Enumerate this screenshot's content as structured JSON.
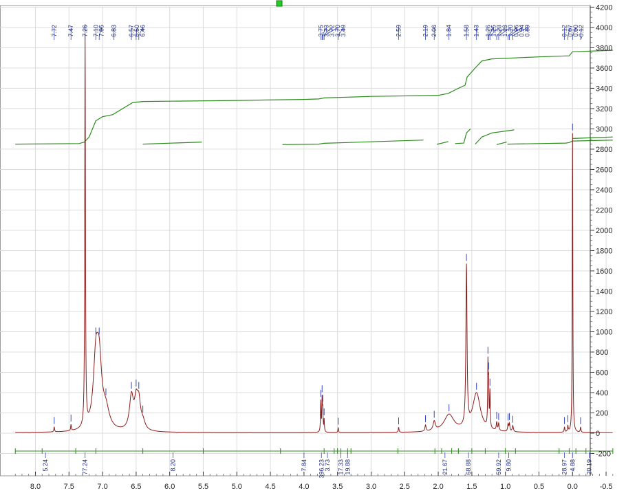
{
  "chart_data": {
    "type": "line",
    "title": "",
    "xlabel": "",
    "ylabel": "",
    "x_reversed": true,
    "xlim": [
      8.3,
      -0.6
    ],
    "ylim": [
      -250,
      4230
    ],
    "grid": true,
    "x_ticks": [
      "8.0",
      "7.5",
      "7.0",
      "6.5",
      "6.0",
      "5.5",
      "5.0",
      "4.5",
      "4.0",
      "3.5",
      "3.0",
      "2.5",
      "2.0",
      "1.5",
      "1.0",
      "0.5",
      "0.0",
      "-0.5"
    ],
    "y_ticks": [
      "4200",
      "4000",
      "3800",
      "3600",
      "3400",
      "3200",
      "3000",
      "2800",
      "2600",
      "2400",
      "2200",
      "2000",
      "1800",
      "1600",
      "1400",
      "1200",
      "1000",
      "800",
      "600",
      "400",
      "200",
      "0",
      "-200"
    ],
    "spectrum": {
      "name": "1H spectrum",
      "color": "#8b1a1a",
      "baseline": 5,
      "peaks": [
        {
          "ppm": 7.72,
          "height": 50,
          "width": 0.006
        },
        {
          "ppm": 7.47,
          "height": 60,
          "width": 0.006
        },
        {
          "ppm": 7.26,
          "height": 3850,
          "width": 0.006
        },
        {
          "ppm": 7.1,
          "height": 640,
          "width": 0.045
        },
        {
          "ppm": 7.05,
          "height": 600,
          "width": 0.045
        },
        {
          "ppm": 6.95,
          "height": 180,
          "width": 0.06
        },
        {
          "ppm": 6.57,
          "height": 330,
          "width": 0.035
        },
        {
          "ppm": 6.5,
          "height": 250,
          "width": 0.03
        },
        {
          "ppm": 6.46,
          "height": 250,
          "width": 0.03
        },
        {
          "ppm": 6.4,
          "height": 80,
          "width": 0.04
        },
        {
          "ppm": 3.75,
          "height": 300,
          "width": 0.005
        },
        {
          "ppm": 3.73,
          "height": 310,
          "width": 0.005
        },
        {
          "ppm": 3.72,
          "height": 200,
          "width": 0.005
        },
        {
          "ppm": 3.7,
          "height": 120,
          "width": 0.005
        },
        {
          "ppm": 3.49,
          "height": 50,
          "width": 0.005
        },
        {
          "ppm": 2.59,
          "height": 50,
          "width": 0.006
        },
        {
          "ppm": 2.19,
          "height": 60,
          "width": 0.01
        },
        {
          "ppm": 2.06,
          "height": 90,
          "width": 0.02
        },
        {
          "ppm": 1.84,
          "height": 170,
          "width": 0.09
        },
        {
          "ppm": 1.58,
          "height": 1580,
          "width": 0.01
        },
        {
          "ppm": 1.43,
          "height": 380,
          "width": 0.07
        },
        {
          "ppm": 1.26,
          "height": 600,
          "width": 0.005
        },
        {
          "ppm": 1.25,
          "height": 400,
          "width": 0.005
        },
        {
          "ppm": 1.23,
          "height": 350,
          "width": 0.005
        },
        {
          "ppm": 1.13,
          "height": 80,
          "width": 0.008
        },
        {
          "ppm": 1.1,
          "height": 70,
          "width": 0.008
        },
        {
          "ppm": 0.96,
          "height": 70,
          "width": 0.008
        },
        {
          "ppm": 0.94,
          "height": 75,
          "width": 0.008
        },
        {
          "ppm": 0.89,
          "height": 60,
          "width": 0.01
        },
        {
          "ppm": 0.12,
          "height": 50,
          "width": 0.006
        },
        {
          "ppm": 0.07,
          "height": 60,
          "width": 0.006
        },
        {
          "ppm": 0.0,
          "height": 2950,
          "width": 0.005
        },
        {
          "ppm": -0.12,
          "height": 50,
          "width": 0.006
        }
      ]
    },
    "peak_labels": [
      "7.72",
      "7.47",
      "7.26",
      "7.10",
      "7.05",
      "6.83",
      "6.57",
      "6.50",
      "6.46",
      "3.75",
      "3.73",
      "3.72",
      "3.70",
      "3.49",
      "2.59",
      "2.19",
      "2.06",
      "1.84",
      "1.58",
      "1.43",
      "1.26",
      "1.25",
      "1.23",
      "1.13",
      "1.10",
      "0.96",
      "0.94",
      "0.89",
      "0.12",
      "0.07",
      "0.00",
      "-0.12"
    ],
    "integral_curve": {
      "name": "integral",
      "color": "#2a8a1a",
      "segments": [
        [
          [
            8.3,
            2850
          ],
          [
            7.35,
            2855
          ],
          [
            7.27,
            2870
          ],
          [
            7.2,
            2920
          ],
          [
            7.1,
            3080
          ],
          [
            7.0,
            3120
          ],
          [
            6.85,
            3140
          ],
          [
            6.7,
            3200
          ],
          [
            6.55,
            3260
          ],
          [
            6.4,
            3270
          ],
          [
            5.0,
            3280
          ],
          [
            4.0,
            3290
          ],
          [
            3.78,
            3295
          ],
          [
            3.7,
            3305
          ],
          [
            3.0,
            3320
          ],
          [
            2.0,
            3330
          ],
          [
            1.85,
            3350
          ],
          [
            1.7,
            3400
          ],
          [
            1.6,
            3430
          ],
          [
            1.57,
            3510
          ],
          [
            1.45,
            3600
          ],
          [
            1.35,
            3670
          ],
          [
            1.2,
            3690
          ],
          [
            0.5,
            3710
          ],
          [
            0.05,
            3720
          ],
          [
            0.0,
            3760
          ],
          [
            -0.6,
            3775
          ]
        ]
      ]
    },
    "integral_fragments": [
      [
        [
          6.4,
          2850
        ],
        [
          5.52,
          2870
        ]
      ],
      [
        [
          4.32,
          2845
        ],
        [
          3.78,
          2850
        ],
        [
          3.7,
          2858
        ],
        [
          2.22,
          2890
        ]
      ],
      [
        [
          2.02,
          2848
        ],
        [
          1.85,
          2875
        ]
      ],
      [
        [
          1.75,
          2855
        ],
        [
          1.62,
          2860
        ],
        [
          1.58,
          2960
        ],
        [
          1.52,
          3000
        ]
      ],
      [
        [
          1.45,
          2850
        ],
        [
          1.35,
          2920
        ],
        [
          1.2,
          2960
        ],
        [
          0.87,
          2990
        ]
      ],
      [
        [
          1.13,
          2845
        ],
        [
          0.98,
          2870
        ]
      ],
      [
        [
          0.97,
          2850
        ],
        [
          0.1,
          2860
        ],
        [
          0.05,
          2865
        ],
        [
          0.0,
          2880
        ],
        [
          -0.6,
          2890
        ]
      ],
      [
        [
          0.0,
          2905
        ],
        [
          -0.6,
          2920
        ]
      ]
    ],
    "integrals": [
      {
        "label": "5.24",
        "ppm": 7.85
      },
      {
        "label": "77.24",
        "ppm": 7.26
      },
      {
        "label": "8.20",
        "ppm": 5.95
      },
      {
        "label": "7.84",
        "ppm": 4.0
      },
      {
        "label": "396.23",
        "ppm": 3.74
      },
      {
        "label": "3.73",
        "ppm": 3.65
      },
      {
        "label": "17.33",
        "ppm": 3.45
      },
      {
        "label": "19.88",
        "ppm": 3.35
      },
      {
        "label": "21.67",
        "ppm": 1.9
      },
      {
        "label": "68.88",
        "ppm": 1.55
      },
      {
        "label": "59.92",
        "ppm": 1.1
      },
      {
        "label": "9.80",
        "ppm": 0.95
      },
      {
        "label": "28.97",
        "ppm": 0.12
      },
      {
        "label": "4.88",
        "ppm": 0.0
      },
      {
        "label": "20.19",
        "ppm": -0.25
      }
    ],
    "integral_bounds": [
      8.3,
      7.9,
      7.4,
      7.1,
      6.4,
      5.5,
      4.35,
      3.7,
      3.55,
      3.5,
      3.45,
      3.35,
      3.3,
      2.6,
      2.05,
      1.95,
      1.8,
      1.7,
      1.5,
      1.3,
      1.0,
      0.85,
      0.2,
      0.05,
      -0.05,
      -0.2,
      -0.6
    ],
    "marker_color": "#22cc22"
  }
}
